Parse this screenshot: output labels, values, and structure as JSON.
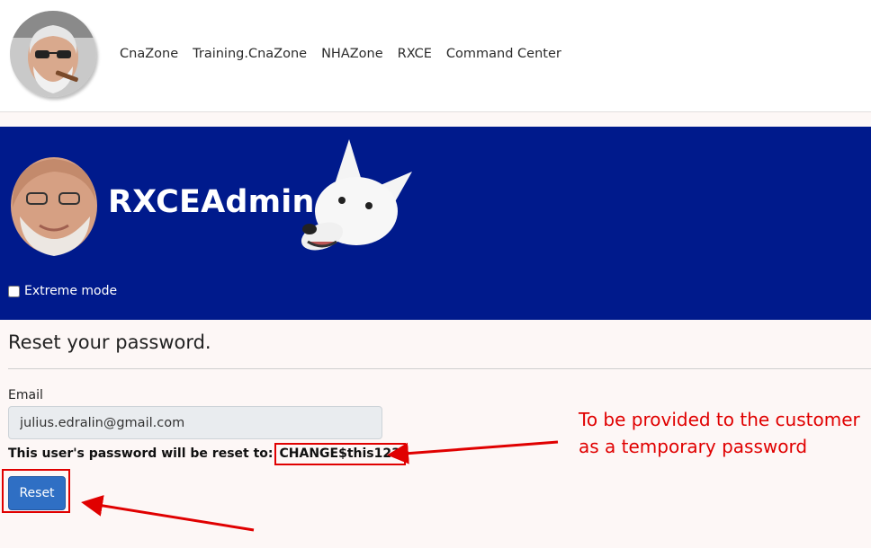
{
  "nav": {
    "links": [
      "CnaZone",
      "Training.CnaZone",
      "NHAZone",
      "RXCE",
      "Command Center"
    ]
  },
  "banner": {
    "title": "RXCEAdmin",
    "extreme_mode_label": "Extreme mode",
    "extreme_mode_checked": false,
    "background_color": "#001a8c"
  },
  "form": {
    "title": "Reset your password.",
    "email_label": "Email",
    "email_value": "julius.edralin@gmail.com",
    "reset_note": "This user's password will be reset to:",
    "temp_password": "CHANGE$this123",
    "reset_button": "Reset"
  },
  "annotation": {
    "text": "To be provided to the customer as a temporary password",
    "color": "#e00000"
  }
}
